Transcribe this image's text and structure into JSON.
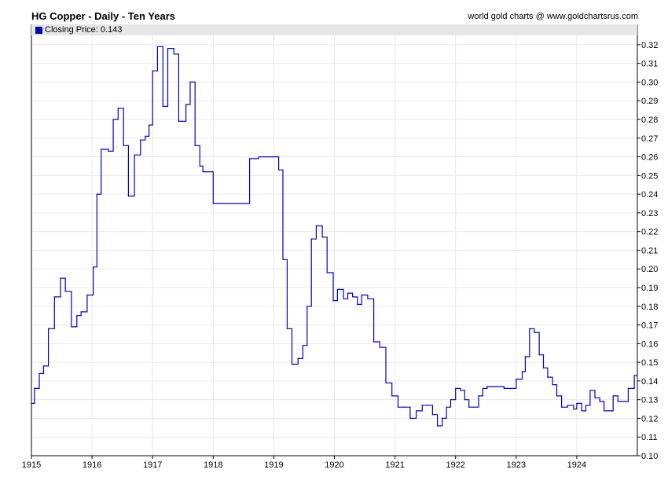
{
  "header": {
    "title": "HG Copper - Daily - Ten Years",
    "credit": "world gold charts @ www.goldchartsrus.com"
  },
  "legend": {
    "label": "Closing Price: 0.143",
    "color": "#0000cc"
  },
  "chart_data": {
    "type": "line",
    "series": [
      {
        "name": "Closing Price",
        "color": "#0000cc",
        "x": [
          1915.0,
          1915.05,
          1915.13,
          1915.2,
          1915.28,
          1915.38,
          1915.48,
          1915.56,
          1915.66,
          1915.75,
          1915.82,
          1915.92,
          1916.02,
          1916.08,
          1916.15,
          1916.27,
          1916.35,
          1916.43,
          1916.52,
          1916.6,
          1916.7,
          1916.8,
          1916.88,
          1916.94,
          1917.0,
          1917.08,
          1917.17,
          1917.25,
          1917.35,
          1917.43,
          1917.55,
          1917.62,
          1917.7,
          1917.78,
          1917.83,
          1918.0,
          1918.2,
          1918.4,
          1918.6,
          1918.75,
          1918.88,
          1919.0,
          1919.08,
          1919.15,
          1919.22,
          1919.3,
          1919.4,
          1919.48,
          1919.55,
          1919.62,
          1919.7,
          1919.8,
          1919.88,
          1919.98,
          1920.05,
          1920.15,
          1920.22,
          1920.3,
          1920.38,
          1920.45,
          1920.55,
          1920.65,
          1920.75,
          1920.85,
          1920.95,
          1921.05,
          1921.15,
          1921.25,
          1921.35,
          1921.45,
          1921.55,
          1921.62,
          1921.7,
          1921.78,
          1921.85,
          1921.92,
          1922.0,
          1922.08,
          1922.15,
          1922.22,
          1922.3,
          1922.38,
          1922.45,
          1922.52,
          1922.6,
          1922.7,
          1922.8,
          1922.9,
          1923.0,
          1923.1,
          1923.15,
          1923.22,
          1923.3,
          1923.38,
          1923.45,
          1923.52,
          1923.6,
          1923.67,
          1923.75,
          1923.85,
          1923.95,
          1924.0,
          1924.08,
          1924.15,
          1924.22,
          1924.3,
          1924.38,
          1924.45,
          1924.52,
          1924.6,
          1924.68,
          1924.75,
          1924.85,
          1924.95
        ],
        "y": [
          0.128,
          0.136,
          0.144,
          0.148,
          0.168,
          0.185,
          0.195,
          0.188,
          0.169,
          0.175,
          0.177,
          0.186,
          0.201,
          0.24,
          0.264,
          0.263,
          0.28,
          0.286,
          0.266,
          0.239,
          0.261,
          0.269,
          0.271,
          0.277,
          0.306,
          0.319,
          0.287,
          0.318,
          0.315,
          0.279,
          0.288,
          0.3,
          0.266,
          0.255,
          0.252,
          0.235,
          0.235,
          0.235,
          0.259,
          0.26,
          0.26,
          0.26,
          0.253,
          0.205,
          0.168,
          0.149,
          0.152,
          0.159,
          0.18,
          0.216,
          0.223,
          0.217,
          0.198,
          0.183,
          0.189,
          0.184,
          0.187,
          0.185,
          0.181,
          0.186,
          0.184,
          0.161,
          0.158,
          0.139,
          0.132,
          0.126,
          0.126,
          0.12,
          0.124,
          0.127,
          0.127,
          0.122,
          0.116,
          0.12,
          0.126,
          0.13,
          0.136,
          0.135,
          0.13,
          0.126,
          0.126,
          0.132,
          0.136,
          0.137,
          0.137,
          0.137,
          0.136,
          0.136,
          0.141,
          0.145,
          0.153,
          0.168,
          0.166,
          0.154,
          0.147,
          0.142,
          0.138,
          0.132,
          0.126,
          0.127,
          0.125,
          0.128,
          0.124,
          0.127,
          0.135,
          0.131,
          0.129,
          0.124,
          0.124,
          0.132,
          0.129,
          0.129,
          0.136,
          0.143
        ]
      }
    ],
    "xlim": [
      1915,
      1925
    ],
    "ylim": [
      0.1,
      0.325
    ],
    "x_ticks": [
      1915,
      1916,
      1917,
      1918,
      1919,
      1920,
      1921,
      1922,
      1923,
      1924
    ],
    "y_ticks": [
      0.1,
      0.11,
      0.12,
      0.13,
      0.14,
      0.15,
      0.16,
      0.17,
      0.18,
      0.19,
      0.2,
      0.21,
      0.22,
      0.23,
      0.24,
      0.25,
      0.26,
      0.27,
      0.28,
      0.29,
      0.3,
      0.31,
      0.32
    ],
    "grid": true,
    "step": true,
    "legend_position": "top-left",
    "colors": {
      "grid": "#e8e8e8",
      "axis": "#000000",
      "legend_bg": "#e6e6e6"
    }
  }
}
